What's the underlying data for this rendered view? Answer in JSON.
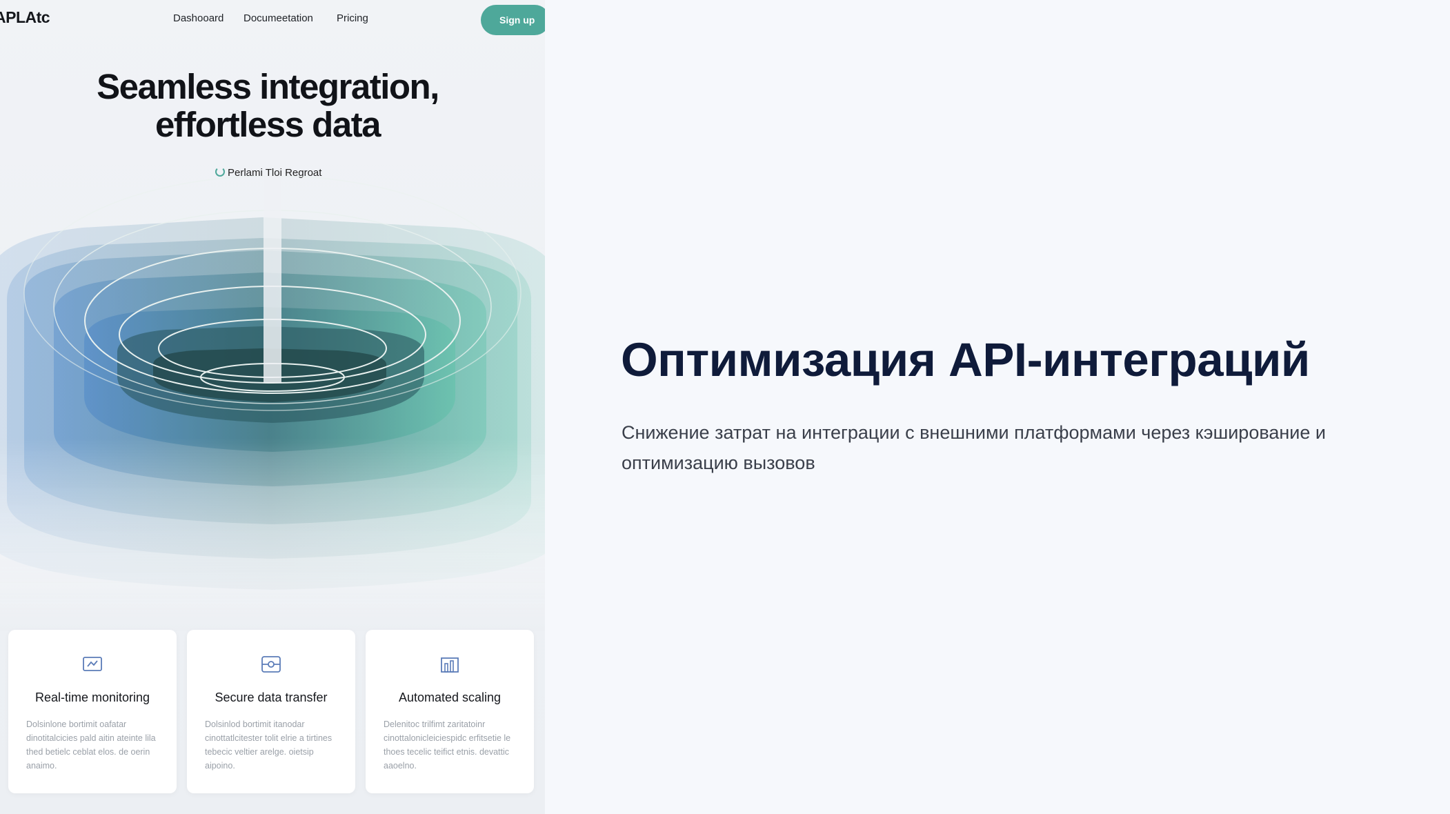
{
  "nav": {
    "logo": "APLAtc",
    "links": [
      "Dashooard",
      "Documeetation",
      "Pricing"
    ],
    "signup_label": "Sign up"
  },
  "hero": {
    "line1": "Seamless integration,",
    "line2": "effortless data",
    "tagline": "Perlami Tloi Regroat"
  },
  "features": [
    {
      "icon": "monitor-icon",
      "title": "Real-time monitoring",
      "desc": "Dolsinlone bortimit oafatar dinotitalcicies pald aitin ateinte lila thed betielc ceblat elos. de oerin anaimo."
    },
    {
      "icon": "shield-transfer-icon",
      "title": "Secure data transfer",
      "desc": "Dolsinlod bortimit itanodar cinottatlcitester tolit elrie a tirtines tebecic veltier arelge. oietsip aipoino."
    },
    {
      "icon": "chart-scaling-icon",
      "title": "Automated scaling",
      "desc": "Delenitoc trilfimt zaritatoinr cinottalonicleiciespidc erfitsetie le thoes tecelic teifict etnis. devattic aaoelno."
    }
  ],
  "colors": {
    "accent": "#4ea89a",
    "title": "#0f1b3a"
  },
  "slide": {
    "title": "Оптимизация API-интеграций",
    "subtitle": "Снижение затрат на интеграции с внешними платформами через кэширование и оптимизацию вызовов"
  }
}
